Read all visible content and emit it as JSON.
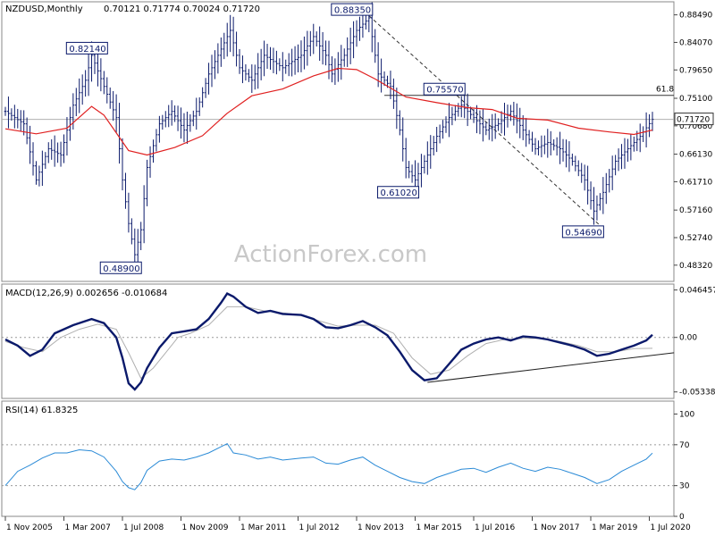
{
  "chart_data": [
    {
      "type": "candlestick",
      "title": "NZDUSD,Monthly",
      "ohlc_readout": "0.70121 0.71774 0.70024 0.71720",
      "ylim": [
        0.46,
        0.903
      ],
      "y_ticks": [
        "0.88490",
        "0.84070",
        "0.79650",
        "0.75100",
        "0.70680",
        "0.66130",
        "0.61710",
        "0.57160",
        "0.52740",
        "0.48320"
      ],
      "current_price": "0.71720",
      "x_labels": [
        "1 Nov 2005",
        "1 Mar 2007",
        "1 Jul 2008",
        "1 Nov 2009",
        "1 Mar 2011",
        "1 Jul 2012",
        "1 Nov 2013",
        "1 Mar 2015",
        "1 Jul 2016",
        "1 Nov 2017",
        "1 Mar 2019",
        "1 Jul 2020"
      ],
      "annotations": [
        {
          "label": "0.82140",
          "value": 0.8214
        },
        {
          "label": "0.48900",
          "value": 0.489
        },
        {
          "label": "0.88350",
          "value": 0.8835
        },
        {
          "label": "0.61020",
          "value": 0.6102
        },
        {
          "label": "0.75570",
          "value": 0.7557
        },
        {
          "label": "0.54690",
          "value": 0.5469
        }
      ],
      "fib_level_label": "61.8",
      "fib_level_value": 0.7557,
      "moving_average": [
        [
          0,
          0.702
        ],
        [
          10,
          0.694
        ],
        [
          20,
          0.703
        ],
        [
          28,
          0.738
        ],
        [
          32,
          0.724
        ],
        [
          40,
          0.667
        ],
        [
          46,
          0.66
        ],
        [
          55,
          0.672
        ],
        [
          64,
          0.691
        ],
        [
          72,
          0.727
        ],
        [
          80,
          0.755
        ],
        [
          90,
          0.766
        ],
        [
          100,
          0.787
        ],
        [
          108,
          0.799
        ],
        [
          114,
          0.797
        ],
        [
          120,
          0.782
        ],
        [
          130,
          0.753
        ],
        [
          140,
          0.744
        ],
        [
          150,
          0.736
        ],
        [
          158,
          0.733
        ],
        [
          166,
          0.719
        ],
        [
          176,
          0.716
        ],
        [
          186,
          0.703
        ],
        [
          196,
          0.697
        ],
        [
          204,
          0.693
        ],
        [
          210,
          0.7
        ]
      ],
      "price_path": [
        [
          0,
          0.73
        ],
        [
          6,
          0.71
        ],
        [
          10,
          0.62
        ],
        [
          14,
          0.67
        ],
        [
          18,
          0.66
        ],
        [
          22,
          0.74
        ],
        [
          26,
          0.78
        ],
        [
          28,
          0.82
        ],
        [
          32,
          0.77
        ],
        [
          36,
          0.72
        ],
        [
          38,
          0.62
        ],
        [
          40,
          0.55
        ],
        [
          42,
          0.5
        ],
        [
          44,
          0.54
        ],
        [
          46,
          0.64
        ],
        [
          50,
          0.71
        ],
        [
          54,
          0.73
        ],
        [
          58,
          0.7
        ],
        [
          62,
          0.73
        ],
        [
          66,
          0.79
        ],
        [
          70,
          0.83
        ],
        [
          73,
          0.86
        ],
        [
          76,
          0.8
        ],
        [
          80,
          0.78
        ],
        [
          84,
          0.82
        ],
        [
          90,
          0.8
        ],
        [
          96,
          0.82
        ],
        [
          100,
          0.85
        ],
        [
          104,
          0.82
        ],
        [
          106,
          0.79
        ],
        [
          110,
          0.82
        ],
        [
          114,
          0.86
        ],
        [
          118,
          0.88
        ],
        [
          121,
          0.79
        ],
        [
          125,
          0.77
        ],
        [
          128,
          0.7
        ],
        [
          130,
          0.64
        ],
        [
          133,
          0.62
        ],
        [
          136,
          0.65
        ],
        [
          140,
          0.69
        ],
        [
          144,
          0.72
        ],
        [
          148,
          0.74
        ],
        [
          152,
          0.72
        ],
        [
          156,
          0.7
        ],
        [
          160,
          0.71
        ],
        [
          164,
          0.73
        ],
        [
          168,
          0.7
        ],
        [
          172,
          0.67
        ],
        [
          176,
          0.68
        ],
        [
          180,
          0.67
        ],
        [
          184,
          0.65
        ],
        [
          188,
          0.62
        ],
        [
          191,
          0.57
        ],
        [
          194,
          0.6
        ],
        [
          198,
          0.65
        ],
        [
          202,
          0.67
        ],
        [
          206,
          0.69
        ],
        [
          210,
          0.7172
        ]
      ]
    },
    {
      "type": "line",
      "title": "MACD(12,26,9) 0.002656 -0.010684",
      "ylim": [
        -0.058,
        0.0505
      ],
      "y_ticks": [
        "0.046457",
        "0.00",
        "-0.053383"
      ],
      "main_line": [
        [
          0,
          -0.002
        ],
        [
          4,
          -0.008
        ],
        [
          8,
          -0.018
        ],
        [
          12,
          -0.012
        ],
        [
          16,
          0.004
        ],
        [
          22,
          0.012
        ],
        [
          28,
          0.018
        ],
        [
          32,
          0.014
        ],
        [
          36,
          0.0
        ],
        [
          38,
          -0.02
        ],
        [
          40,
          -0.045
        ],
        [
          42,
          -0.051
        ],
        [
          44,
          -0.044
        ],
        [
          46,
          -0.03
        ],
        [
          50,
          -0.01
        ],
        [
          54,
          0.004
        ],
        [
          58,
          0.006
        ],
        [
          62,
          0.008
        ],
        [
          66,
          0.018
        ],
        [
          70,
          0.034
        ],
        [
          72,
          0.043
        ],
        [
          74,
          0.04
        ],
        [
          78,
          0.03
        ],
        [
          82,
          0.024
        ],
        [
          86,
          0.026
        ],
        [
          90,
          0.023
        ],
        [
          96,
          0.022
        ],
        [
          100,
          0.018
        ],
        [
          104,
          0.01
        ],
        [
          108,
          0.009
        ],
        [
          112,
          0.012
        ],
        [
          116,
          0.016
        ],
        [
          120,
          0.01
        ],
        [
          124,
          0.002
        ],
        [
          128,
          -0.014
        ],
        [
          132,
          -0.032
        ],
        [
          136,
          -0.042
        ],
        [
          140,
          -0.04
        ],
        [
          144,
          -0.026
        ],
        [
          148,
          -0.012
        ],
        [
          152,
          -0.006
        ],
        [
          156,
          -0.002
        ],
        [
          160,
          0.0
        ],
        [
          164,
          -0.003
        ],
        [
          168,
          0.001
        ],
        [
          172,
          0.0
        ],
        [
          176,
          -0.002
        ],
        [
          180,
          -0.005
        ],
        [
          184,
          -0.008
        ],
        [
          188,
          -0.012
        ],
        [
          192,
          -0.018
        ],
        [
          196,
          -0.016
        ],
        [
          200,
          -0.012
        ],
        [
          204,
          -0.008
        ],
        [
          208,
          -0.003
        ],
        [
          210,
          0.002656
        ]
      ],
      "signal_line": [
        [
          0,
          -0.004
        ],
        [
          6,
          -0.01
        ],
        [
          12,
          -0.014
        ],
        [
          18,
          0.0
        ],
        [
          24,
          0.008
        ],
        [
          30,
          0.013
        ],
        [
          36,
          0.008
        ],
        [
          40,
          -0.015
        ],
        [
          44,
          -0.04
        ],
        [
          48,
          -0.03
        ],
        [
          52,
          -0.015
        ],
        [
          56,
          0.0
        ],
        [
          60,
          0.004
        ],
        [
          66,
          0.012
        ],
        [
          72,
          0.03
        ],
        [
          78,
          0.03
        ],
        [
          84,
          0.026
        ],
        [
          90,
          0.024
        ],
        [
          96,
          0.022
        ],
        [
          102,
          0.016
        ],
        [
          108,
          0.011
        ],
        [
          114,
          0.012
        ],
        [
          120,
          0.012
        ],
        [
          126,
          0.004
        ],
        [
          132,
          -0.02
        ],
        [
          138,
          -0.036
        ],
        [
          144,
          -0.032
        ],
        [
          150,
          -0.018
        ],
        [
          156,
          -0.006
        ],
        [
          162,
          -0.002
        ],
        [
          168,
          -0.001
        ],
        [
          174,
          -0.001
        ],
        [
          180,
          -0.004
        ],
        [
          186,
          -0.008
        ],
        [
          192,
          -0.014
        ],
        [
          198,
          -0.014
        ],
        [
          204,
          -0.011
        ],
        [
          210,
          -0.010684
        ]
      ],
      "trendline": [
        [
          137,
          -0.044
        ],
        [
          217,
          -0.015
        ]
      ]
    },
    {
      "type": "line",
      "title": "RSI(14) 61.8325",
      "ylim": [
        0,
        110
      ],
      "y_ticks": [
        100,
        70,
        30,
        0
      ],
      "levels": [
        70,
        30
      ],
      "values": [
        [
          0,
          30
        ],
        [
          4,
          44
        ],
        [
          8,
          50
        ],
        [
          12,
          57
        ],
        [
          16,
          62
        ],
        [
          20,
          62
        ],
        [
          24,
          65
        ],
        [
          28,
          64
        ],
        [
          32,
          58
        ],
        [
          36,
          44
        ],
        [
          38,
          34
        ],
        [
          40,
          28
        ],
        [
          42,
          26
        ],
        [
          44,
          33
        ],
        [
          46,
          45
        ],
        [
          50,
          54
        ],
        [
          54,
          56
        ],
        [
          58,
          55
        ],
        [
          62,
          58
        ],
        [
          66,
          62
        ],
        [
          70,
          68
        ],
        [
          72,
          71
        ],
        [
          74,
          62
        ],
        [
          78,
          60
        ],
        [
          82,
          56
        ],
        [
          86,
          58
        ],
        [
          90,
          55
        ],
        [
          96,
          57
        ],
        [
          100,
          58
        ],
        [
          104,
          52
        ],
        [
          108,
          51
        ],
        [
          112,
          55
        ],
        [
          116,
          58
        ],
        [
          120,
          50
        ],
        [
          124,
          44
        ],
        [
          128,
          38
        ],
        [
          132,
          34
        ],
        [
          136,
          32
        ],
        [
          140,
          38
        ],
        [
          144,
          42
        ],
        [
          148,
          46
        ],
        [
          152,
          47
        ],
        [
          156,
          43
        ],
        [
          160,
          48
        ],
        [
          164,
          52
        ],
        [
          168,
          47
        ],
        [
          172,
          44
        ],
        [
          176,
          48
        ],
        [
          180,
          46
        ],
        [
          184,
          42
        ],
        [
          188,
          38
        ],
        [
          192,
          32
        ],
        [
          196,
          36
        ],
        [
          200,
          44
        ],
        [
          204,
          50
        ],
        [
          208,
          56
        ],
        [
          210,
          61.8325
        ]
      ]
    }
  ],
  "watermark": "ActionForex.com",
  "colors": {
    "price": "#0b1a6b",
    "ma": "#e02020",
    "macd": "#0b1a6b",
    "signal": "#b0b0b0",
    "rsi": "#2a8ad6",
    "grid": "#9a9a9a",
    "label_box": "#0b1a6b"
  }
}
